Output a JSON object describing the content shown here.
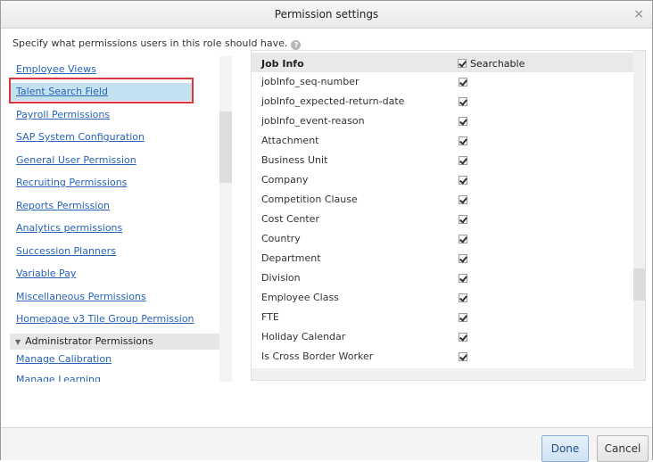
{
  "dialog": {
    "title": "Permission settings",
    "close_glyph": "×",
    "instruction": "Specify what permissions users in this role should have.",
    "help_glyph": "?"
  },
  "left_nav": {
    "items": [
      "Employee Views",
      "Talent Search Field",
      "Payroll Permissions",
      "SAP System Configuration",
      "General User Permission",
      "Recruiting Permissions",
      "Reports Permission",
      "Analytics permissions",
      "Succession Planners",
      "Variable Pay",
      "Miscellaneous Permissions",
      "Homepage v3 Tile Group Permission"
    ],
    "selected": "Talent Search Field",
    "section_header": "Administrator Permissions",
    "section_items": [
      "Manage Calibration",
      "Manage Learning"
    ]
  },
  "fields_table": {
    "header_label": "Job Info",
    "header_check_label": "Searchable",
    "rows": [
      {
        "label": "jobInfo_seq-number",
        "checked": true
      },
      {
        "label": "jobInfo_expected-return-date",
        "checked": true
      },
      {
        "label": "jobInfo_event-reason",
        "checked": true
      },
      {
        "label": "Attachment",
        "checked": true
      },
      {
        "label": "Business Unit",
        "checked": true
      },
      {
        "label": "Company",
        "checked": true
      },
      {
        "label": "Competition Clause",
        "checked": true
      },
      {
        "label": "Cost Center",
        "checked": true
      },
      {
        "label": "Country",
        "checked": true
      },
      {
        "label": "Department",
        "checked": true
      },
      {
        "label": "Division",
        "checked": true
      },
      {
        "label": "Employee Class",
        "checked": true
      },
      {
        "label": "FTE",
        "checked": true
      },
      {
        "label": "Holiday Calendar",
        "checked": true
      },
      {
        "label": "Is Cross Border Worker",
        "checked": true
      }
    ]
  },
  "footer": {
    "done_label": "Done",
    "cancel_label": "Cancel"
  },
  "colors": {
    "link": "#2763b8",
    "selected_row": "#c4e1f0",
    "highlight_border": "#d9363e",
    "done_button": "#cfe1f4"
  }
}
